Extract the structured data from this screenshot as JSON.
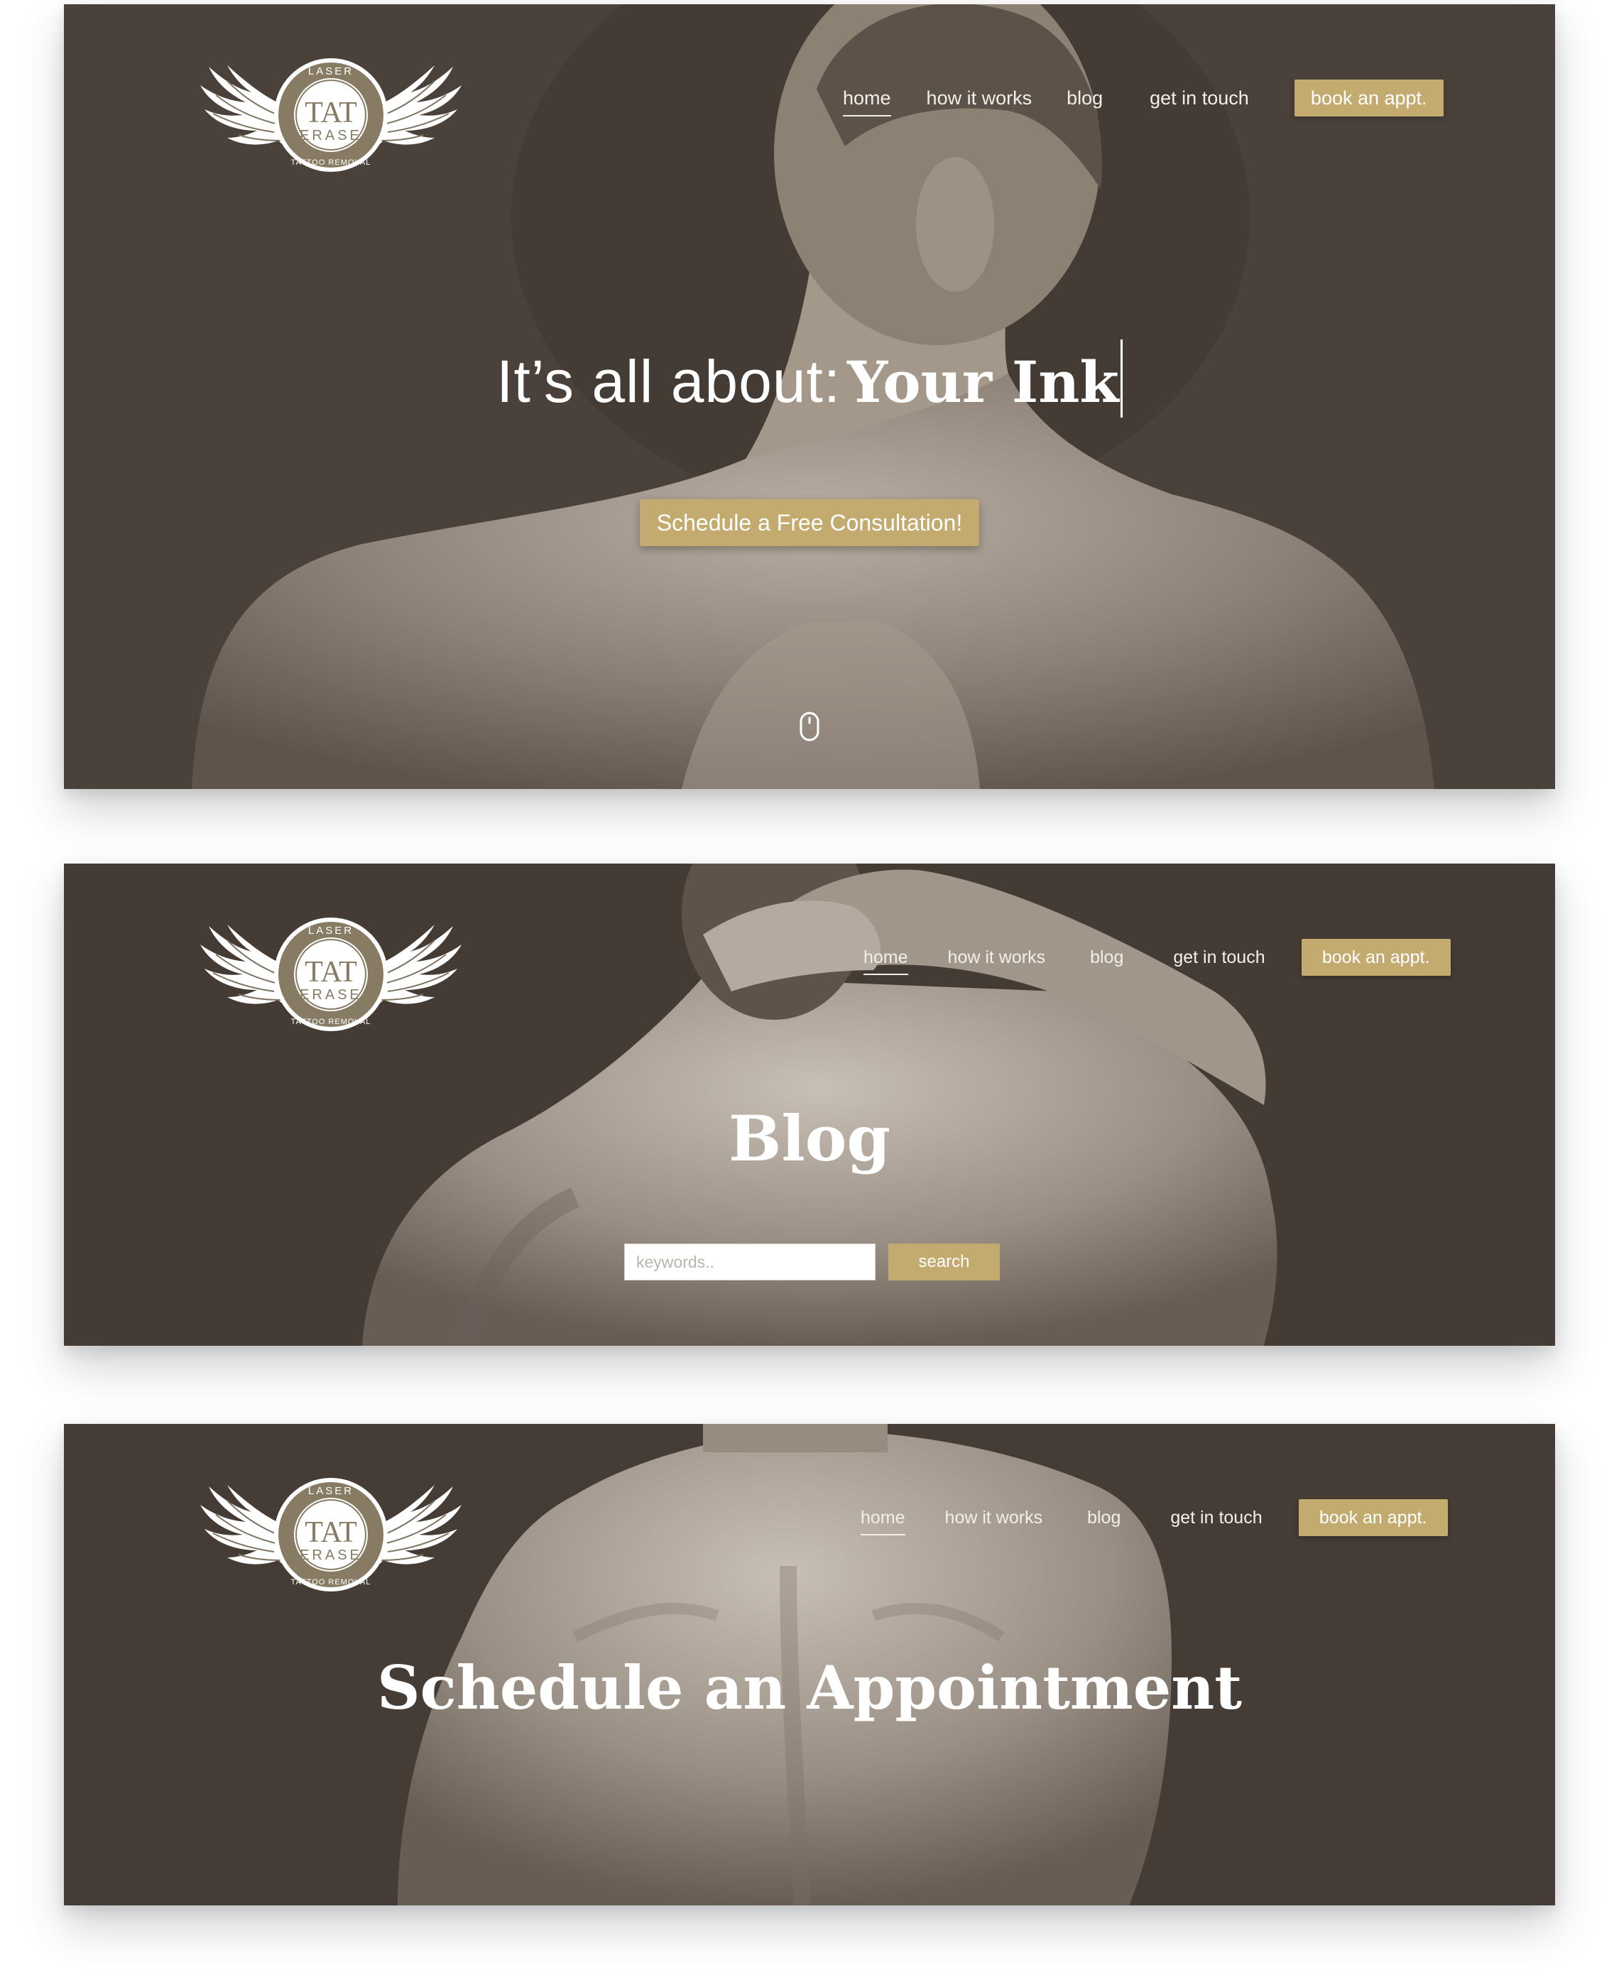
{
  "brand": {
    "logo_top": "LASER",
    "logo_main": "TAT",
    "logo_sub": "ERASE",
    "logo_bottom": "TATTOO REMOVAL"
  },
  "nav": {
    "home": "home",
    "how": "how it works",
    "blog": "blog",
    "contact": "get in touch",
    "book": "book an appt."
  },
  "home": {
    "title_prefix": "It’s all about:",
    "title_emphasis": "Your Ink",
    "cta": "Schedule a Free Consultation!"
  },
  "blog": {
    "title": "Blog",
    "search_placeholder": "keywords..",
    "search_button": "search"
  },
  "appointment": {
    "title": "Schedule an Appointment"
  },
  "colors": {
    "accent": "#c3ab70",
    "panel_bg": "#4a403a",
    "text": "#ffffff"
  },
  "icons": [
    "wings-logo-icon",
    "scroll-mouse-icon"
  ]
}
